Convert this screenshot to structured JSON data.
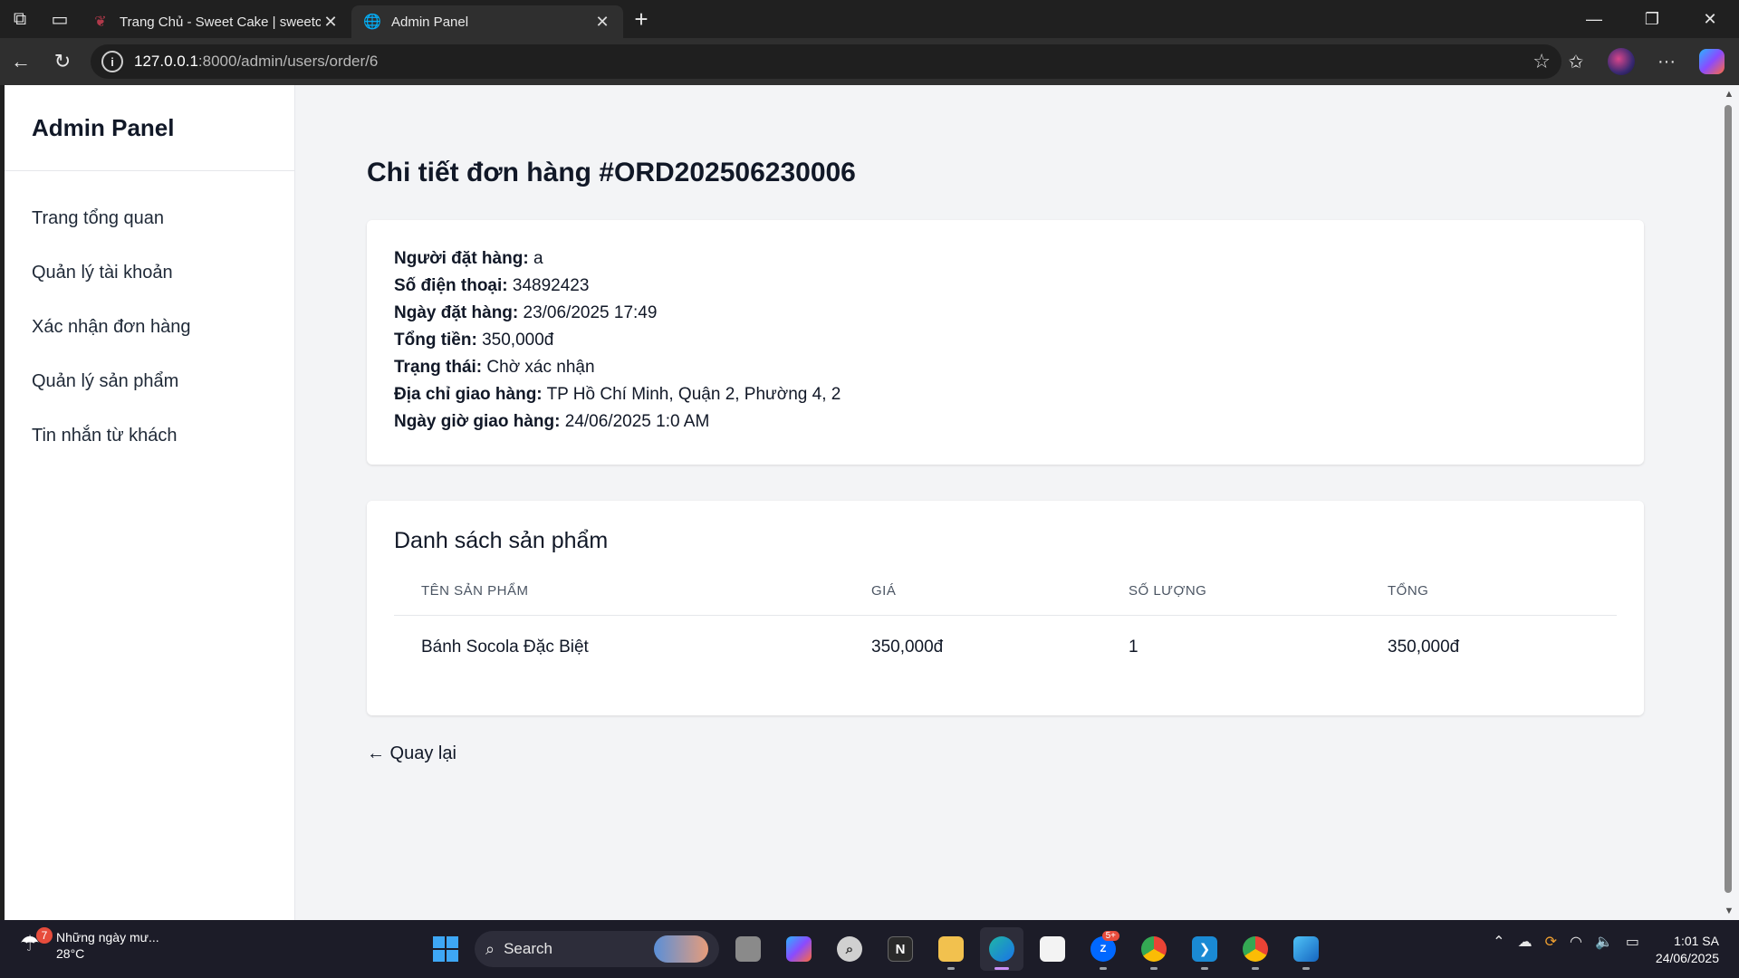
{
  "browser": {
    "tabs": [
      {
        "title": "Trang Chủ - Sweet Cake | sweetcake",
        "favicon": "cake-icon"
      },
      {
        "title": "Admin Panel",
        "favicon": "globe-icon"
      }
    ],
    "url": {
      "host": "127.0.0.1",
      "path": ":8000/admin/users/order/6"
    }
  },
  "sidebar": {
    "brand": "Admin Panel",
    "items": [
      {
        "label": "Trang tổng quan"
      },
      {
        "label": "Quản lý tài khoản"
      },
      {
        "label": "Xác nhận đơn hàng"
      },
      {
        "label": "Quản lý sản phẩm"
      },
      {
        "label": "Tin nhắn từ khách"
      }
    ]
  },
  "order": {
    "title": "Chi tiết đơn hàng #ORD202506230006",
    "fields": [
      {
        "label": "Người đặt hàng:",
        "value": "a"
      },
      {
        "label": "Số điện thoại:",
        "value": "34892423"
      },
      {
        "label": "Ngày đặt hàng:",
        "value": "23/06/2025 17:49"
      },
      {
        "label": "Tổng tiền:",
        "value": "350,000đ"
      },
      {
        "label": "Trạng thái:",
        "value": "Chờ xác nhận"
      },
      {
        "label": "Địa chỉ giao hàng:",
        "value": "TP Hồ Chí Minh, Quận 2, Phường 4, 2"
      },
      {
        "label": "Ngày giờ giao hàng:",
        "value": "24/06/2025 1:0 AM"
      }
    ]
  },
  "products": {
    "heading": "Danh sách sản phẩm",
    "columns": [
      "TÊN SẢN PHẨM",
      "GIÁ",
      "SỐ LƯỢNG",
      "TỔNG"
    ],
    "rows": [
      {
        "name": "Bánh Socola Đặc Biệt",
        "price": "350,000đ",
        "qty": "1",
        "total": "350,000đ"
      }
    ]
  },
  "back_link": "← Quay lại",
  "taskbar": {
    "weather_badge": "7",
    "weather_text": "Những ngày mư...",
    "temperature": "28°C",
    "search_label": "Search",
    "zalo_badge": "5+",
    "time": "1:01 SA",
    "date": "24/06/2025"
  },
  "colors": {
    "accent": "#111827",
    "background": "#f3f4f6"
  }
}
